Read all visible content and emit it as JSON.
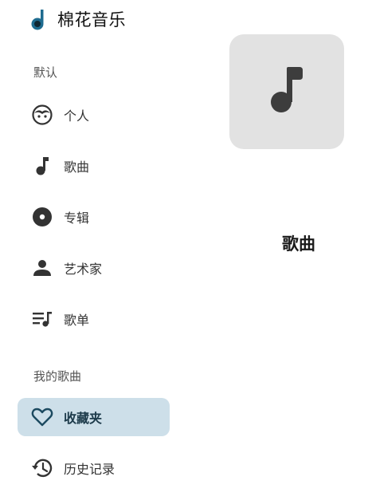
{
  "app": {
    "title": "棉花音乐",
    "brand_color": "#1e6b8f"
  },
  "sidebar": {
    "sections": [
      {
        "label": "默认"
      },
      {
        "label": "我的歌曲"
      }
    ],
    "items": [
      {
        "label": "个人",
        "icon": "face-icon",
        "active": false
      },
      {
        "label": "歌曲",
        "icon": "music-note-icon",
        "active": false
      },
      {
        "label": "专辑",
        "icon": "album-disc-icon",
        "active": false
      },
      {
        "label": "艺术家",
        "icon": "person-icon",
        "active": false
      },
      {
        "label": "歌单",
        "icon": "playlist-icon",
        "active": false
      },
      {
        "label": "收藏夹",
        "icon": "heart-outline-icon",
        "active": true
      },
      {
        "label": "历史记录",
        "icon": "history-icon",
        "active": false
      }
    ],
    "active_bg": "#cddfe9"
  },
  "detail": {
    "title": "歌曲",
    "cover_icon": "music-note-icon",
    "cover_bg": "#e2e2e2"
  }
}
